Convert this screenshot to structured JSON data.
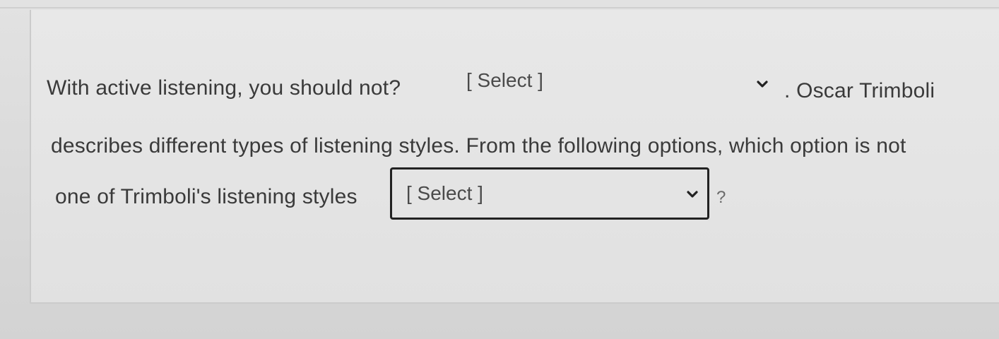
{
  "question": {
    "line1_prefix": "With active listening, you should not?",
    "line1_suffix": ". Oscar Trimboli",
    "line2": "describes different types of listening styles. From the following options, which option is not",
    "line3_prefix": "one of Trimboli's listening styles",
    "line3_suffix": "?"
  },
  "dropdowns": {
    "first": {
      "selected": "[ Select ]"
    },
    "second": {
      "selected": "[ Select ]"
    }
  },
  "icons": {
    "first_chevron": "chevron-down-icon",
    "second_chevron": "chevron-down-icon"
  }
}
